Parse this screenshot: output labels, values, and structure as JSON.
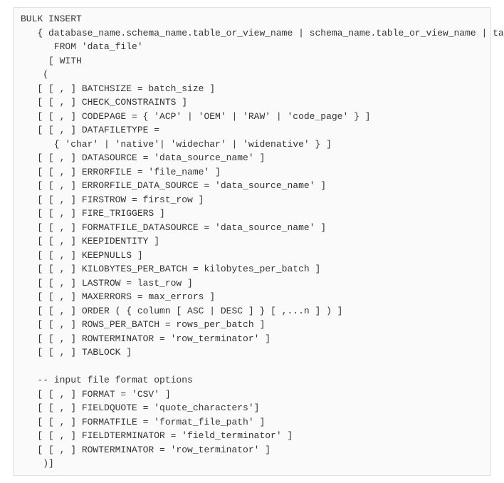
{
  "code": {
    "lines": [
      "BULK INSERT",
      "   { database_name.schema_name.table_or_view_name | schema_name.table_or_view_name | table",
      "      FROM 'data_file'",
      "     [ WITH",
      "    (",
      "   [ [ , ] BATCHSIZE = batch_size ]",
      "   [ [ , ] CHECK_CONSTRAINTS ]",
      "   [ [ , ] CODEPAGE = { 'ACP' | 'OEM' | 'RAW' | 'code_page' } ]",
      "   [ [ , ] DATAFILETYPE =",
      "      { 'char' | 'native'| 'widechar' | 'widenative' } ]",
      "   [ [ , ] DATASOURCE = 'data_source_name' ]",
      "   [ [ , ] ERRORFILE = 'file_name' ]",
      "   [ [ , ] ERRORFILE_DATA_SOURCE = 'data_source_name' ]",
      "   [ [ , ] FIRSTROW = first_row ]",
      "   [ [ , ] FIRE_TRIGGERS ]",
      "   [ [ , ] FORMATFILE_DATASOURCE = 'data_source_name' ]",
      "   [ [ , ] KEEPIDENTITY ]",
      "   [ [ , ] KEEPNULLS ]",
      "   [ [ , ] KILOBYTES_PER_BATCH = kilobytes_per_batch ]",
      "   [ [ , ] LASTROW = last_row ]",
      "   [ [ , ] MAXERRORS = max_errors ]",
      "   [ [ , ] ORDER ( { column [ ASC | DESC ] } [ ,...n ] ) ]",
      "   [ [ , ] ROWS_PER_BATCH = rows_per_batch ]",
      "   [ [ , ] ROWTERMINATOR = 'row_terminator' ]",
      "   [ [ , ] TABLOCK ]",
      "",
      "   -- input file format options",
      "   [ [ , ] FORMAT = 'CSV' ]",
      "   [ [ , ] FIELDQUOTE = 'quote_characters']",
      "   [ [ , ] FORMATFILE = 'format_file_path' ]",
      "   [ [ , ] FIELDTERMINATOR = 'field_terminator' ]",
      "   [ [ , ] ROWTERMINATOR = 'row_terminator' ]",
      "    )]"
    ]
  }
}
